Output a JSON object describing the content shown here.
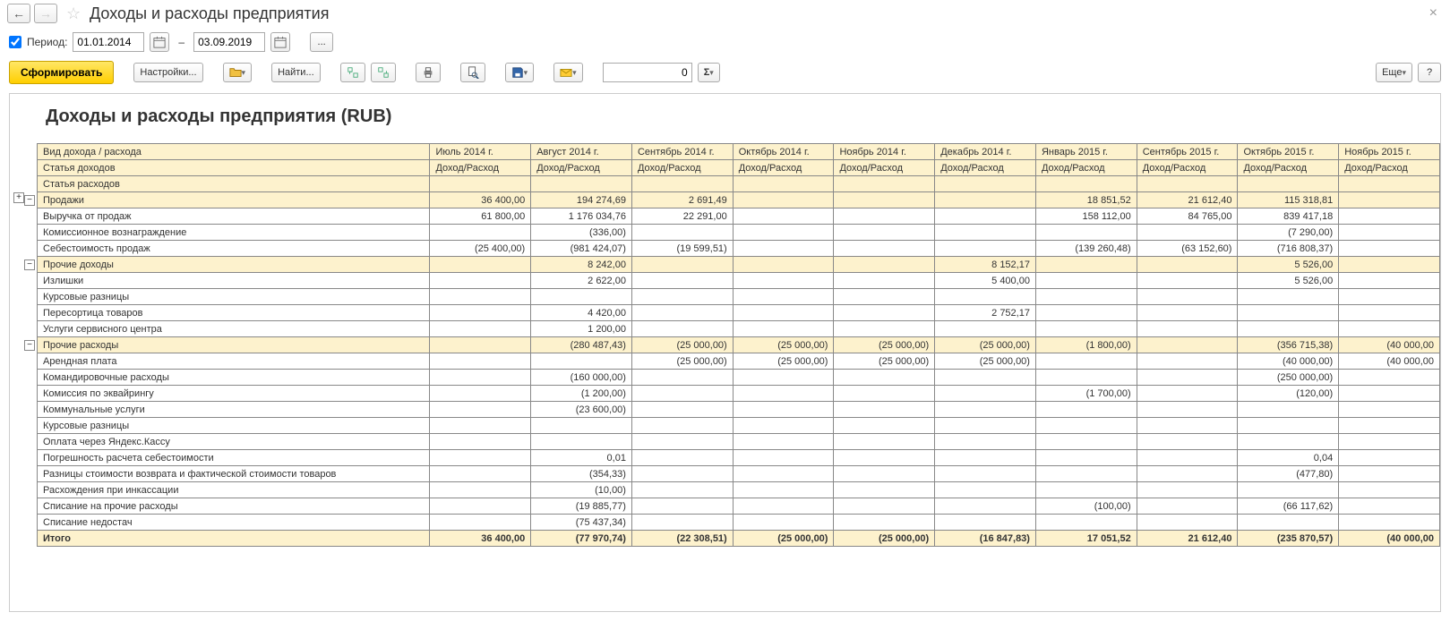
{
  "title": "Доходы и расходы предприятия",
  "period": {
    "label": "Период:",
    "from": "01.01.2014",
    "to": "03.09.2019",
    "dash": "–"
  },
  "toolbar": {
    "generate": "Сформировать",
    "settings": "Настройки...",
    "find": "Найти...",
    "more": "Еще",
    "help": "?",
    "ellipsis": "...",
    "num_value": "0",
    "sigma": "Σ"
  },
  "report": {
    "title": "Доходы и расходы предприятия (RUB)",
    "header_rows": [
      {
        "label": "Вид дохода / расхода",
        "cells": [
          "Июль 2014 г.",
          "Август 2014 г.",
          "Сентябрь 2014 г.",
          "Октябрь 2014 г.",
          "Ноябрь 2014 г.",
          "Декабрь 2014 г.",
          "Январь 2015 г.",
          "Сентябрь 2015 г.",
          "Октябрь 2015 г.",
          "Ноябрь 2015 г."
        ]
      },
      {
        "label": "Статья доходов",
        "cells": [
          "Доход/Расход",
          "Доход/Расход",
          "Доход/Расход",
          "Доход/Расход",
          "Доход/Расход",
          "Доход/Расход",
          "Доход/Расход",
          "Доход/Расход",
          "Доход/Расход",
          "Доход/Расход"
        ]
      },
      {
        "label": "Статья расходов",
        "cells": [
          "",
          "",
          "",
          "",
          "",
          "",
          "",
          "",
          "",
          ""
        ]
      }
    ],
    "rows": [
      {
        "type": "group",
        "indent": 1,
        "label": "Продажи",
        "cells": [
          "36 400,00",
          "194 274,69",
          "2 691,49",
          "",
          "",
          "",
          "18 851,52",
          "21 612,40",
          "115 318,81",
          ""
        ]
      },
      {
        "type": "data",
        "indent": 2,
        "label": "Выручка от продаж",
        "cells": [
          "61 800,00",
          "1 176 034,76",
          "22 291,00",
          "",
          "",
          "",
          "158 112,00",
          "84 765,00",
          "839 417,18",
          ""
        ]
      },
      {
        "type": "data",
        "indent": 2,
        "label": "Комиссионное вознаграждение",
        "cells": [
          "",
          "(336,00)",
          "",
          "",
          "",
          "",
          "",
          "",
          "(7 290,00)",
          ""
        ]
      },
      {
        "type": "data",
        "indent": 2,
        "label": "Себестоимость продаж",
        "cells": [
          "(25 400,00)",
          "(981 424,07)",
          "(19 599,51)",
          "",
          "",
          "",
          "(139 260,48)",
          "(63 152,60)",
          "(716 808,37)",
          ""
        ]
      },
      {
        "type": "group",
        "indent": 1,
        "label": "Прочие доходы",
        "cells": [
          "",
          "8 242,00",
          "",
          "",
          "",
          "8 152,17",
          "",
          "",
          "5 526,00",
          ""
        ]
      },
      {
        "type": "data",
        "indent": 2,
        "label": "Излишки",
        "cells": [
          "",
          "2 622,00",
          "",
          "",
          "",
          "5 400,00",
          "",
          "",
          "5 526,00",
          ""
        ]
      },
      {
        "type": "data",
        "indent": 2,
        "label": "Курсовые разницы",
        "cells": [
          "",
          "",
          "",
          "",
          "",
          "",
          "",
          "",
          "",
          ""
        ]
      },
      {
        "type": "data",
        "indent": 2,
        "label": "Пересортица товаров",
        "cells": [
          "",
          "4 420,00",
          "",
          "",
          "",
          "2 752,17",
          "",
          "",
          "",
          ""
        ]
      },
      {
        "type": "data",
        "indent": 2,
        "label": "Услуги сервисного центра",
        "cells": [
          "",
          "1 200,00",
          "",
          "",
          "",
          "",
          "",
          "",
          "",
          ""
        ]
      },
      {
        "type": "group",
        "indent": 1,
        "label": "Прочие расходы",
        "cells": [
          "",
          "(280 487,43)",
          "(25 000,00)",
          "(25 000,00)",
          "(25 000,00)",
          "(25 000,00)",
          "(1 800,00)",
          "",
          "(356 715,38)",
          "(40 000,00"
        ]
      },
      {
        "type": "data",
        "indent": 2,
        "label": "Арендная плата",
        "cells": [
          "",
          "",
          "(25 000,00)",
          "(25 000,00)",
          "(25 000,00)",
          "(25 000,00)",
          "",
          "",
          "(40 000,00)",
          "(40 000,00"
        ]
      },
      {
        "type": "data",
        "indent": 2,
        "label": "Командировочные расходы",
        "cells": [
          "",
          "(160 000,00)",
          "",
          "",
          "",
          "",
          "",
          "",
          "(250 000,00)",
          ""
        ]
      },
      {
        "type": "data",
        "indent": 2,
        "label": "Комиссия по эквайрингу",
        "cells": [
          "",
          "(1 200,00)",
          "",
          "",
          "",
          "",
          "(1 700,00)",
          "",
          "(120,00)",
          ""
        ]
      },
      {
        "type": "data",
        "indent": 2,
        "label": "Коммунальные услуги",
        "cells": [
          "",
          "(23 600,00)",
          "",
          "",
          "",
          "",
          "",
          "",
          "",
          ""
        ]
      },
      {
        "type": "data",
        "indent": 2,
        "label": "Курсовые разницы",
        "cells": [
          "",
          "",
          "",
          "",
          "",
          "",
          "",
          "",
          "",
          ""
        ]
      },
      {
        "type": "data",
        "indent": 2,
        "label": "Оплата через Яндекс.Кассу",
        "cells": [
          "",
          "",
          "",
          "",
          "",
          "",
          "",
          "",
          "",
          ""
        ]
      },
      {
        "type": "data",
        "indent": 2,
        "label": "Погрешность расчета себестоимости",
        "cells": [
          "",
          "0,01",
          "",
          "",
          "",
          "",
          "",
          "",
          "0,04",
          ""
        ]
      },
      {
        "type": "data",
        "indent": 2,
        "label": "Разницы стоимости возврата и фактической стоимости товаров",
        "cells": [
          "",
          "(354,33)",
          "",
          "",
          "",
          "",
          "",
          "",
          "(477,80)",
          ""
        ]
      },
      {
        "type": "data",
        "indent": 2,
        "label": "Расхождения при инкассации",
        "cells": [
          "",
          "(10,00)",
          "",
          "",
          "",
          "",
          "",
          "",
          "",
          ""
        ]
      },
      {
        "type": "data",
        "indent": 2,
        "label": "Списание на прочие расходы",
        "cells": [
          "",
          "(19 885,77)",
          "",
          "",
          "",
          "",
          "(100,00)",
          "",
          "(66 117,62)",
          ""
        ]
      },
      {
        "type": "data",
        "indent": 2,
        "label": "Списание недостач",
        "cells": [
          "",
          "(75 437,34)",
          "",
          "",
          "",
          "",
          "",
          "",
          "",
          ""
        ]
      },
      {
        "type": "total",
        "indent": 1,
        "label": "Итого",
        "cells": [
          "36 400,00",
          "(77 970,74)",
          "(22 308,51)",
          "(25 000,00)",
          "(25 000,00)",
          "(16 847,83)",
          "17 051,52",
          "21 612,40",
          "(235 870,57)",
          "(40 000,00"
        ]
      }
    ]
  }
}
